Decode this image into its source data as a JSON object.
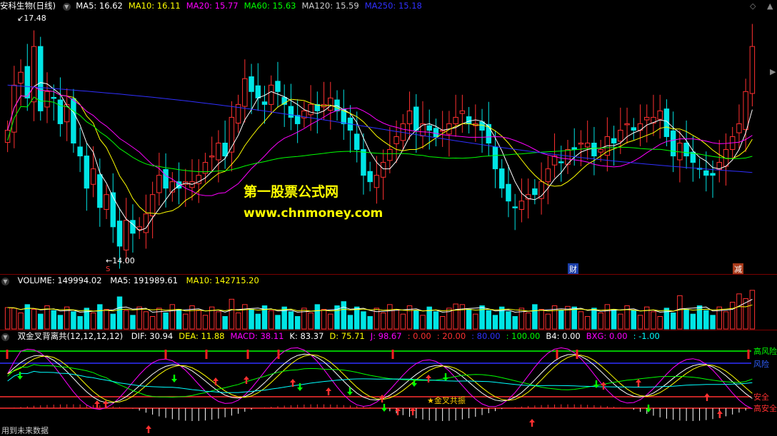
{
  "main": {
    "title": "安科生物(日线)",
    "indicators": [
      {
        "label": "MA5: 16.62",
        "color": "#ffffff"
      },
      {
        "label": "MA10: 16.11",
        "color": "#ffff00"
      },
      {
        "label": "MA20: 15.77",
        "color": "#ff00ff"
      },
      {
        "label": "MA60: 15.63",
        "color": "#00ff00"
      },
      {
        "label": "MA120: 15.59",
        "color": "#cccccc"
      },
      {
        "label": "MA250: 15.18",
        "color": "#3030ff"
      }
    ],
    "high_label": "17.48",
    "low_label": "14.00",
    "marker_s": "S",
    "badge_cai": "财",
    "badge_jian": "减",
    "watermark_cn": "第一股票公式网",
    "watermark_url": "www.chnmoney.com",
    "candles": [
      15.9,
      16.6,
      16.8,
      16.4,
      17.2,
      16.2,
      16.5,
      16.4,
      16.0,
      16.3,
      15.7,
      15.5,
      15.0,
      15.3,
      14.7,
      14.9,
      14.4,
      14.1,
      14.5,
      14.3,
      14.4,
      14.6,
      14.9,
      15.2,
      15.0,
      15.1,
      15.0,
      15.1,
      15.1,
      15.2,
      15.4,
      15.5,
      15.7,
      15.5,
      16.1,
      16.3,
      16.7,
      16.5,
      16.4,
      16.3,
      16.6,
      16.5,
      16.3,
      16.1,
      16.0,
      16.2,
      16.3,
      16.2,
      16.3,
      16.4,
      16.2,
      16.0,
      15.9,
      15.6,
      15.2,
      15.1,
      15.2,
      15.4,
      15.6,
      15.8,
      16.0,
      16.2,
      15.9,
      16.0,
      15.9,
      15.8,
      15.9,
      16.0,
      16.1,
      16.2,
      16.0,
      16.0,
      15.9,
      15.7,
      15.3,
      15.0,
      14.8,
      14.7,
      14.8,
      14.9,
      14.9,
      15.1,
      15.3,
      15.5,
      15.4,
      15.6,
      15.6,
      15.7,
      15.7,
      15.5,
      15.6,
      15.8,
      15.7,
      15.9,
      16.0,
      15.9,
      16.0,
      16.1,
      16.1,
      16.2,
      15.8,
      15.5,
      15.7,
      15.5,
      15.4,
      15.3,
      15.2,
      15.2,
      15.4,
      15.6,
      15.8,
      16.0,
      16.5,
      17.2
    ]
  },
  "volume": {
    "title": "VOLUME: 149994.02",
    "ma5": "MA5: 191989.61",
    "ma10": "MA10: 142715.20"
  },
  "indicator": {
    "title": "双金叉背离共(12,12,12,12)",
    "items": [
      {
        "label": "DIF: 30.94",
        "color": "#ffffff"
      },
      {
        "label": "DEA: 11.88",
        "color": "#ffff00"
      },
      {
        "label": "MACD: 38.11",
        "color": "#ff00ff"
      },
      {
        "label": "K: 83.37",
        "color": "#ffffff"
      },
      {
        "label": "D: 75.71",
        "color": "#ffff00"
      },
      {
        "label": "J: 98.67",
        "color": "#ff00ff"
      },
      {
        "label": ": 0.00",
        "color": "#ff3030"
      },
      {
        "label": ": 20.00",
        "color": "#ff3030"
      },
      {
        "label": ": 80.00",
        "color": "#3030ff"
      },
      {
        "label": ": 100.00",
        "color": "#00ff00"
      },
      {
        "label": "B4: 0.00",
        "color": "#ffffff"
      },
      {
        "label": "BXG: 0.00",
        "color": "#ff00ff"
      },
      {
        "label": ": -1.00",
        "color": "#00ffff"
      }
    ],
    "right_labels": [
      "高风险",
      "风险",
      "安全",
      "高安全"
    ],
    "star_label": "★金叉共振",
    "bottom_text": "用到未来数据"
  },
  "colors": {
    "up": "#ff3030",
    "down": "#00e5e5",
    "ma5": "#ffffff",
    "ma10": "#ffff00",
    "ma20": "#ff00ff",
    "ma60": "#00ff00",
    "ma250": "#3030ff"
  }
}
